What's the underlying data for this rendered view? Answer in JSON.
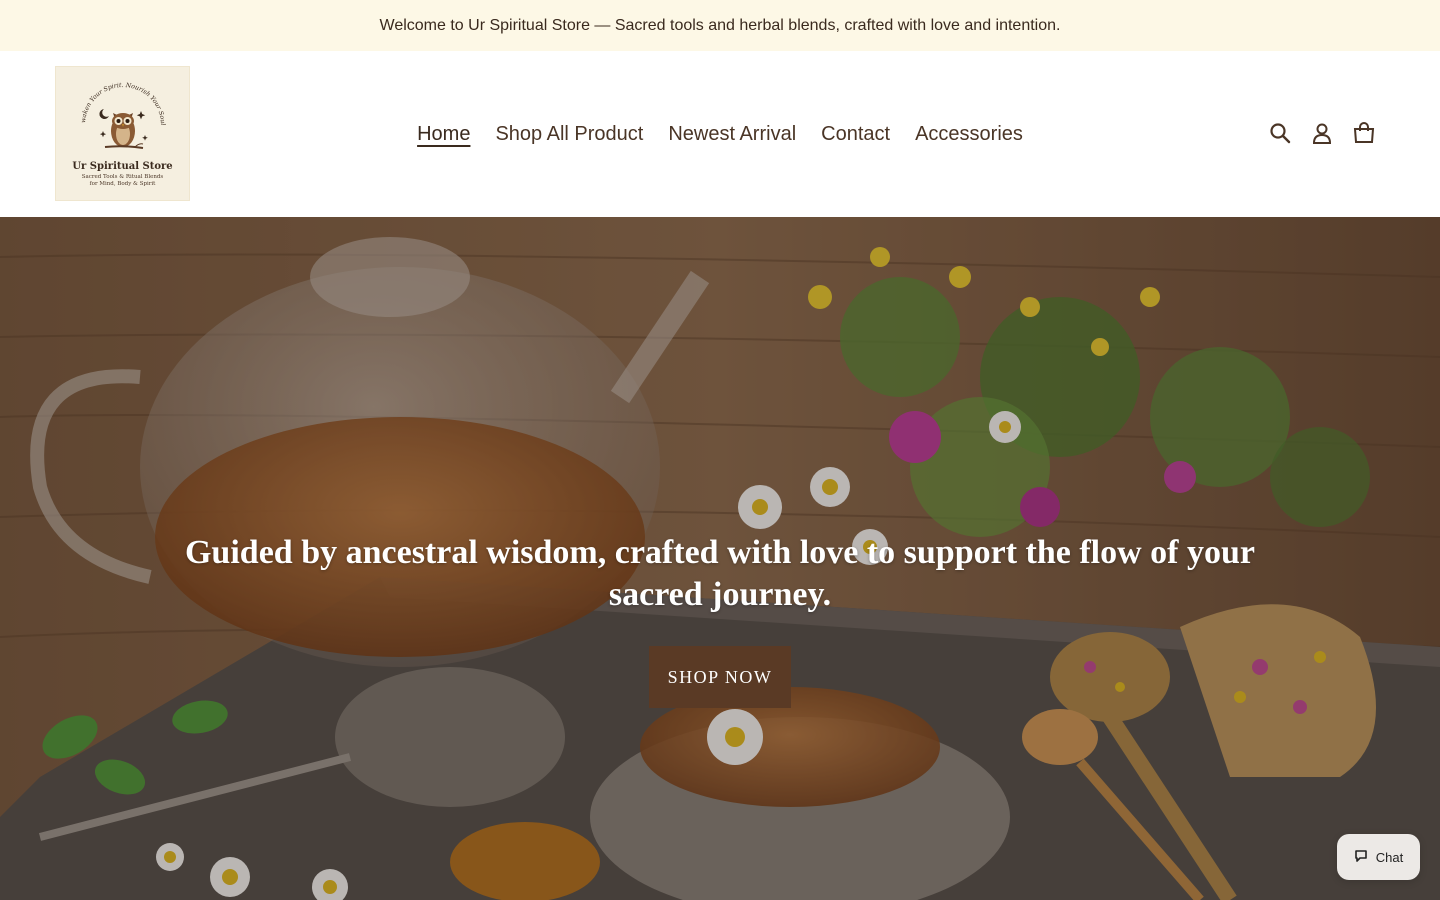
{
  "announcement": {
    "text": "Welcome to Ur Spiritual Store — Sacred tools and herbal blends, crafted with love and intention."
  },
  "logo": {
    "arc_text": "Awaken Your Spirit. Nourish Your Soul.",
    "name": "Ur Spiritual Store",
    "tagline_line1": "Sacred Tools & Ritual Blends",
    "tagline_line2": "for Mind, Body & Spirit"
  },
  "nav": {
    "items": [
      {
        "label": "Home",
        "active": true
      },
      {
        "label": "Shop All Product",
        "active": false
      },
      {
        "label": "Newest Arrival",
        "active": false
      },
      {
        "label": "Contact",
        "active": false
      },
      {
        "label": "Accessories",
        "active": false
      }
    ]
  },
  "header_icons": [
    "search-icon",
    "account-icon",
    "cart-icon"
  ],
  "hero": {
    "heading": "Guided by ancestral wisdom, crafted with love to support the flow of your sacred journey.",
    "button_label": "SHOP NOW"
  },
  "chat": {
    "label": "Chat"
  },
  "colors": {
    "announcement_bg": "#fdf8e6",
    "brand_brown": "#5a3a25",
    "text_dark": "#3a2a1e"
  }
}
